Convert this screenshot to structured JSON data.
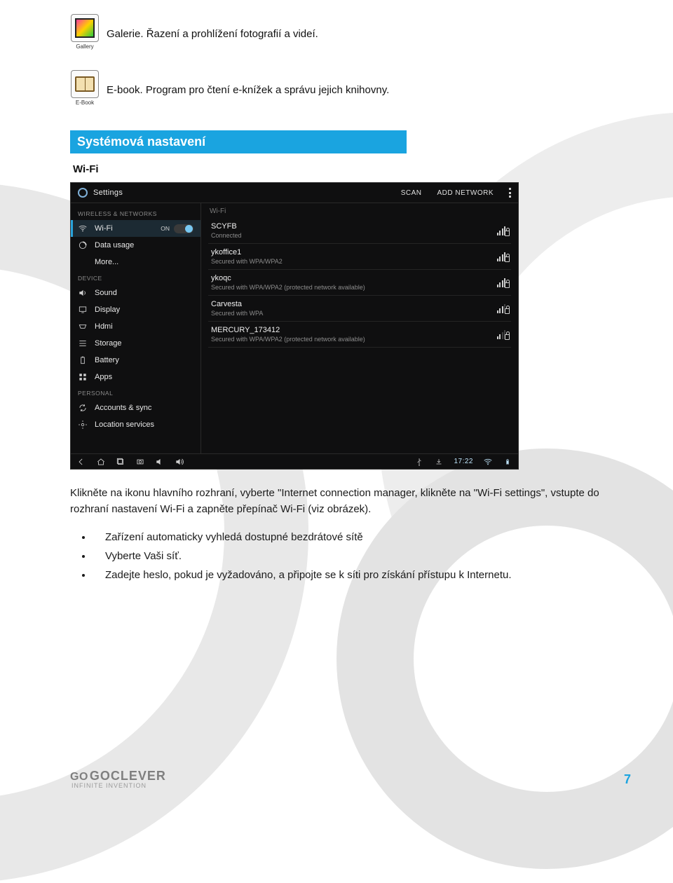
{
  "apps": {
    "gallery": {
      "caption": "Gallery",
      "text": "Galerie. Řazení a prohlížení fotografií a videí."
    },
    "ebook": {
      "caption": "E-Book",
      "text": "E-book. Program pro čtení e-knížek a správu jejich knihovny."
    }
  },
  "heading": "Systémová nastavení",
  "subheading": "Wi-Fi",
  "screenshot": {
    "topbar": {
      "title": "Settings",
      "scan": "SCAN",
      "add": "ADD NETWORK"
    },
    "sections": {
      "wireless": "WIRELESS & NETWORKS",
      "device": "DEVICE",
      "personal": "PERSONAL"
    },
    "side": {
      "wifi": "Wi-Fi",
      "wifi_on": "ON",
      "data": "Data usage",
      "more": "More...",
      "sound": "Sound",
      "display": "Display",
      "hdmi": "Hdmi",
      "storage": "Storage",
      "battery": "Battery",
      "apps": "Apps",
      "accounts": "Accounts & sync",
      "location": "Location services"
    },
    "main_title": "Wi-Fi",
    "networks": [
      {
        "ssid": "SCYFB",
        "sub": "Connected"
      },
      {
        "ssid": "ykoffice1",
        "sub": "Secured with WPA/WPA2"
      },
      {
        "ssid": "ykoqc",
        "sub": "Secured with WPA/WPA2 (protected network available)"
      },
      {
        "ssid": "Carvesta",
        "sub": "Secured with WPA"
      },
      {
        "ssid": "MERCURY_173412",
        "sub": "Secured with WPA/WPA2 (protected network available)"
      }
    ],
    "clock": "17:22"
  },
  "para": "Klikněte na ikonu hlavního rozhraní, vyberte \"Internet connection manager, klikněte na \"Wi-Fi settings\", vstupte do rozhraní nastavení Wi-Fi a zapněte přepínač Wi-Fi (viz obrázek).",
  "bullets": [
    "Zařízení automaticky vyhledá dostupné bezdrátové sítě",
    "Vyberte Vaši síť.",
    "Zadejte heslo, pokud je vyžadováno, a připojte se k síti pro získání přístupu k Internetu."
  ],
  "footer": {
    "go": "GO",
    "brand": "GOCLEVER",
    "tag": "INFINITE INVENTION",
    "page": "7"
  }
}
